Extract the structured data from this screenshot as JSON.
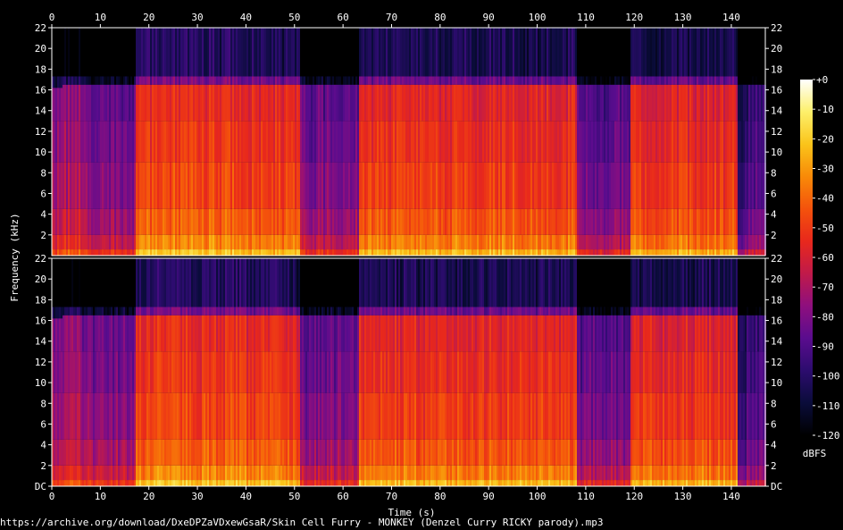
{
  "source": "https://archive.org/download/DxeDPZaVDxewGsaR/Skin Cell Furry - MONKEY (Denzel Curry RICKY parody).mp3",
  "chart_data": {
    "type": "heatmap",
    "xlabel": "Time (s)",
    "ylabel": "Frequency (kHz)",
    "x_ticks": [
      "0",
      "10",
      "20",
      "30",
      "40",
      "50",
      "60",
      "70",
      "80",
      "90",
      "100",
      "110",
      "120",
      "130",
      "140"
    ],
    "xlim": [
      0,
      147
    ],
    "y_ticks_upper": [
      "2",
      "4",
      "6",
      "8",
      "10",
      "12",
      "14",
      "16",
      "18",
      "20",
      "22"
    ],
    "y_ticks_lower": [
      "DC",
      "2",
      "4",
      "6",
      "8",
      "10",
      "12",
      "14",
      "16",
      "18",
      "20",
      "22"
    ],
    "ylim_khz": [
      0,
      22
    ],
    "channels": 2,
    "colorbar": {
      "label": "dBFS",
      "ticks": [
        "+0",
        "-10",
        "-20",
        "-30",
        "-40",
        "-50",
        "-60",
        "-70",
        "-80",
        "-90",
        "-100",
        "-110",
        "-120"
      ],
      "range": [
        -120,
        0
      ],
      "colors": [
        "#000000",
        "#0a0c3a",
        "#2c0c6e",
        "#5a0c8e",
        "#8e0f7e",
        "#c01a4a",
        "#e8281c",
        "#f4520c",
        "#f88a08",
        "#fac41a",
        "#fdf06a",
        "#ffffff"
      ]
    },
    "segments": [
      {
        "start": 0,
        "end": 2,
        "level": -75,
        "cutoff_khz": 16.2
      },
      {
        "start": 2,
        "end": 6,
        "level": -72,
        "cutoff_khz": 16.5
      },
      {
        "start": 6,
        "end": 17,
        "level": -80,
        "cutoff_khz": 16.5
      },
      {
        "start": 17,
        "end": 40,
        "level": -50,
        "cutoff_khz": 16.5
      },
      {
        "start": 40,
        "end": 51,
        "level": -52,
        "cutoff_khz": 16.5
      },
      {
        "start": 51,
        "end": 63,
        "level": -82,
        "cutoff_khz": 16.5
      },
      {
        "start": 63,
        "end": 108,
        "level": -52,
        "cutoff_khz": 16.5
      },
      {
        "start": 108,
        "end": 119,
        "level": -85,
        "cutoff_khz": 16.5
      },
      {
        "start": 119,
        "end": 141,
        "level": -53,
        "cutoff_khz": 16.5
      },
      {
        "start": 141,
        "end": 143,
        "level": -100,
        "cutoff_khz": 16.5
      },
      {
        "start": 143,
        "end": 147,
        "level": -92,
        "cutoff_khz": 16.5
      }
    ]
  }
}
